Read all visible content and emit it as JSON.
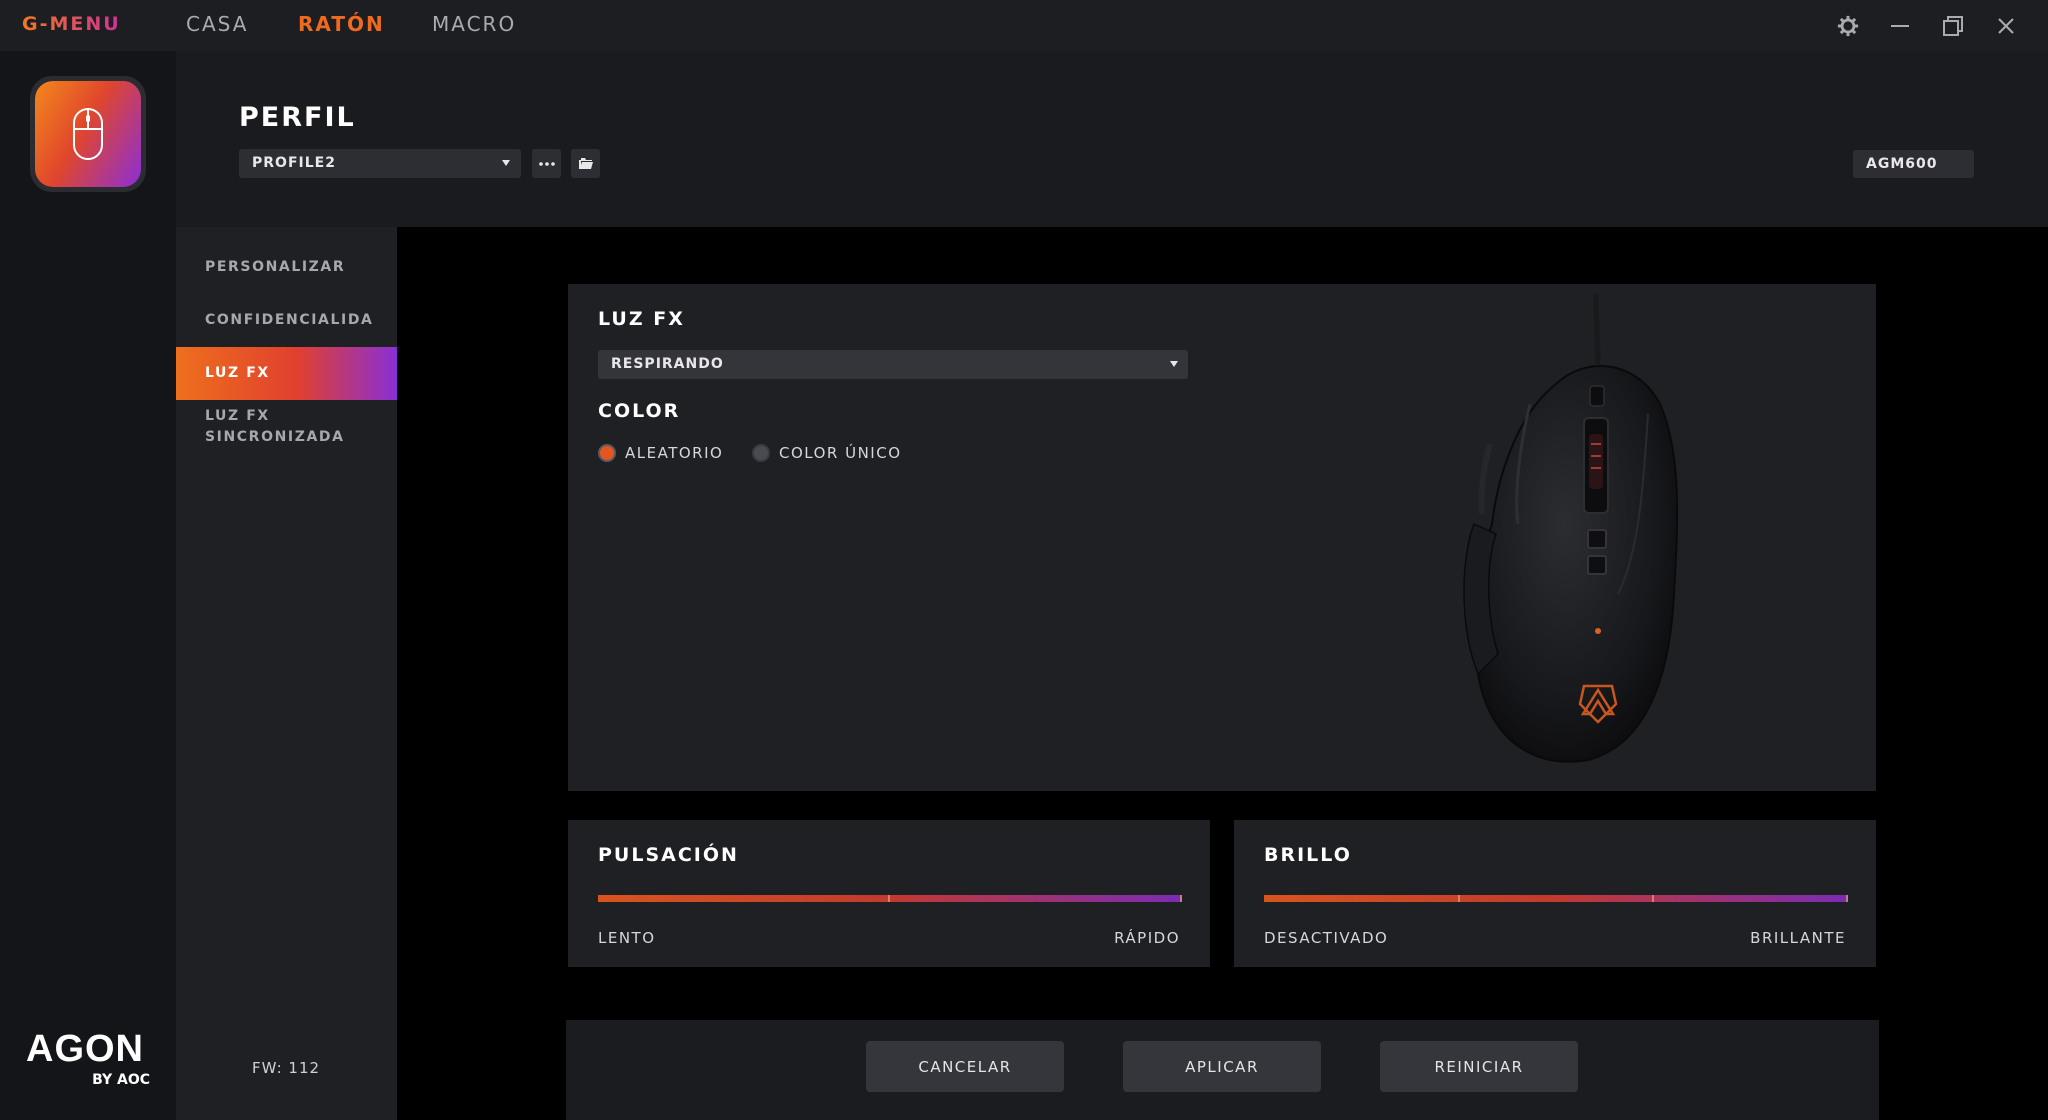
{
  "app": {
    "brand": "G-MENU",
    "nav": [
      {
        "label": "CASA"
      },
      {
        "label": "RATÓN"
      },
      {
        "label": "MACRO"
      }
    ]
  },
  "rail": {
    "logo_big": "AGON",
    "logo_small": "BY AOC"
  },
  "header": {
    "title": "PERFIL",
    "profile_value": "PROFILE2",
    "model": "AGM600"
  },
  "subnav": {
    "items": [
      {
        "label": "PERSONALIZAR"
      },
      {
        "label": "CONFIDENCIALIDA"
      },
      {
        "label": "LUZ FX"
      },
      {
        "label": "LUZ FX SINCRONIZADA"
      }
    ],
    "firmware": "FW: 112"
  },
  "luzfx": {
    "title": "LUZ FX",
    "effect_value": "RESPIRANDO",
    "color_title": "COLOR",
    "option_random": "ALEATORIO",
    "option_single": "COLOR ÚNICO",
    "selected": "ALEATORIO"
  },
  "pulse": {
    "title": "PULSACIÓN",
    "min_label": "LENTO",
    "max_label": "RÁPIDO"
  },
  "brightness": {
    "title": "BRILLO",
    "min_label": "DESACTIVADO",
    "max_label": "BRILLANTE"
  },
  "actions": {
    "cancel": "CANCELAR",
    "apply": "APLICAR",
    "reset": "REINICIAR"
  },
  "colors": {
    "accent_orange": "#ef6a1e",
    "accent_purple": "#8a2fd6"
  }
}
